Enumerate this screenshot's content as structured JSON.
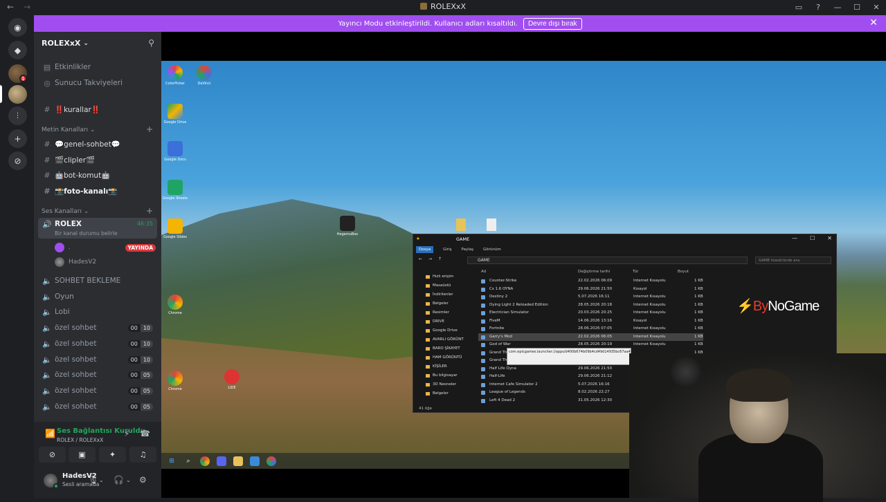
{
  "window": {
    "title": "ROLEXxX",
    "nav_back": "←",
    "nav_fwd": "→"
  },
  "banner": {
    "text": "Yayıncı Modu etkinleştirildi. Kullanıcı adları kısaltıldı.",
    "button": "Devre dışı bırak"
  },
  "server": {
    "name": "ROLEXxX"
  },
  "nav_items": [
    {
      "label": "Etkinlikler",
      "icon": "calendar-icon"
    },
    {
      "label": "Sunucu Takviyeleri",
      "icon": "boost-icon"
    }
  ],
  "rules_channel": "‼️kurallar‼️",
  "text_category": "Metin Kanalları",
  "text_channels": [
    "💬genel-sohbet💬",
    "🎬clipler🎬",
    "🤖bot-komut🤖",
    "📸foto-kanalı📸"
  ],
  "voice_category": "Ses Kanalları",
  "active_voice": {
    "name": "ROLEX",
    "time": "46:35",
    "status": "Bir kanal durumu belirle"
  },
  "voice_users": [
    {
      "name": ".",
      "badge": "YAYINDA"
    },
    {
      "name": "HadesV2",
      "badge": ""
    }
  ],
  "voice_channels": [
    {
      "name": "SOHBET BEKLEME",
      "a": "",
      "b": ""
    },
    {
      "name": "Oyun",
      "a": "",
      "b": ""
    },
    {
      "name": "Lobi",
      "a": "",
      "b": ""
    },
    {
      "name": "özel sohbet",
      "a": "00",
      "b": "10"
    },
    {
      "name": "özel sohbet",
      "a": "00",
      "b": "10"
    },
    {
      "name": "özel sohbet",
      "a": "00",
      "b": "10"
    },
    {
      "name": "özel sohbet",
      "a": "00",
      "b": "05"
    },
    {
      "name": "özel sohbet",
      "a": "00",
      "b": "05"
    },
    {
      "name": "özel sohbet",
      "a": "00",
      "b": "05"
    }
  ],
  "voice_panel": {
    "status": "Ses Bağlantısı Kuruldu",
    "sub": "ROLEX / ROLEXxX"
  },
  "user": {
    "name": "HadesV2",
    "status": "Sesli aramada"
  },
  "guild_badge": "1",
  "desktop_icons": [
    {
      "label": "ColorPicker",
      "color": "#e0463a"
    },
    {
      "label": "DaVinci",
      "color": "#444"
    },
    {
      "label": "Google Drive",
      "color": "#3b8ad9"
    },
    {
      "label": "Google Docs",
      "color": "#3b6fd9"
    },
    {
      "label": "Google Sheets",
      "color": "#1fa463"
    },
    {
      "label": "Google Slides",
      "color": "#f4b400"
    },
    {
      "label": "Chrome",
      "color": "#e8e8e8"
    },
    {
      "label": "Chrome",
      "color": "#e8e8e8"
    },
    {
      "label": "LIDE",
      "color": "#d33"
    },
    {
      "label": "HegemuBox",
      "color": "#222"
    }
  ],
  "explorer": {
    "title": "GAME",
    "menu": [
      "Dosya",
      "Giriş",
      "Paylaş",
      "Görünüm"
    ],
    "path": "GAME",
    "search_placeholder": "GAME klasöründe ara",
    "columns": [
      "Ad",
      "Değiştirme tarihi",
      "Tür",
      "Boyut"
    ],
    "nav": [
      "Hızlı erişim",
      "Masaüstü",
      "İndirilenler",
      "Belgeler",
      "Resimler",
      "DRIVE",
      "Google Drive",
      "AVARLI GÖRÜNT",
      "BARO ŞİKAYET",
      "HAM GÖRÜNTÜ",
      "KİŞİLER",
      "Bu bilgisayar",
      "3D Nesneler",
      "Belgeler"
    ],
    "rows": [
      {
        "name": "Counter-Strike",
        "date": "22.02.2026 06:09",
        "type": "Internet Kısayolu",
        "size": "1 KB"
      },
      {
        "name": "Cs 1.6 OYNA",
        "date": "29.06.2026 21:50",
        "type": "Kısayol",
        "size": "1 KB"
      },
      {
        "name": "Destiny 2",
        "date": "5.07.2026 16:11",
        "type": "Internet Kısayolu",
        "size": "1 KB"
      },
      {
        "name": "Dying Light 2 Reloaded Edition",
        "date": "28.05.2026 20:18",
        "type": "Internet Kısayolu",
        "size": "1 KB"
      },
      {
        "name": "Electrician Simulator",
        "date": "20.03.2026 20:25",
        "type": "Internet Kısayolu",
        "size": "1 KB"
      },
      {
        "name": "FiveM",
        "date": "14.06.2026 13:16",
        "type": "Kısayol",
        "size": "1 KB"
      },
      {
        "name": "Fortnite",
        "date": "28.06.2026 07:05",
        "type": "Internet Kısayolu",
        "size": "1 KB"
      },
      {
        "name": "Garry's Mod",
        "date": "22.02.2026 06:05",
        "type": "Internet Kısayolu",
        "size": "1 KB"
      },
      {
        "name": "God of War",
        "date": "28.05.2026 20:19",
        "type": "Internet Kısayolu",
        "size": "1 KB"
      },
      {
        "name": "Grand Th",
        "date": "",
        "type": "",
        "size": "1 KB"
      },
      {
        "name": "Grand Th",
        "date": "",
        "type": "",
        "size": ""
      },
      {
        "name": "Half Life Oyna",
        "date": "29.06.2026 21:50",
        "type": "",
        "size": ""
      },
      {
        "name": "Half-Life",
        "date": "29.06.2026 21:12",
        "type": "",
        "size": ""
      },
      {
        "name": "Internet Cafe Simulator 2",
        "date": "5.07.2026 16:16",
        "type": "",
        "size": ""
      },
      {
        "name": "League of Legends",
        "date": "8.02.2026 22:27",
        "type": "",
        "size": ""
      },
      {
        "name": "Left 4 Dead 2",
        "date": "31.05.2026 12:30",
        "type": "",
        "size": ""
      }
    ],
    "footer": "41 öğe",
    "tooltip": "com.epicgames.launcher://apps/d400b674b09b4cd49d14935bc67aa453%3A18a71d5c8f6c44299075%3A019b8e62a48c4278ac5ca98d7986cd75?..."
  },
  "watermark": {
    "brand": "By",
    "rest": "NoGame"
  }
}
